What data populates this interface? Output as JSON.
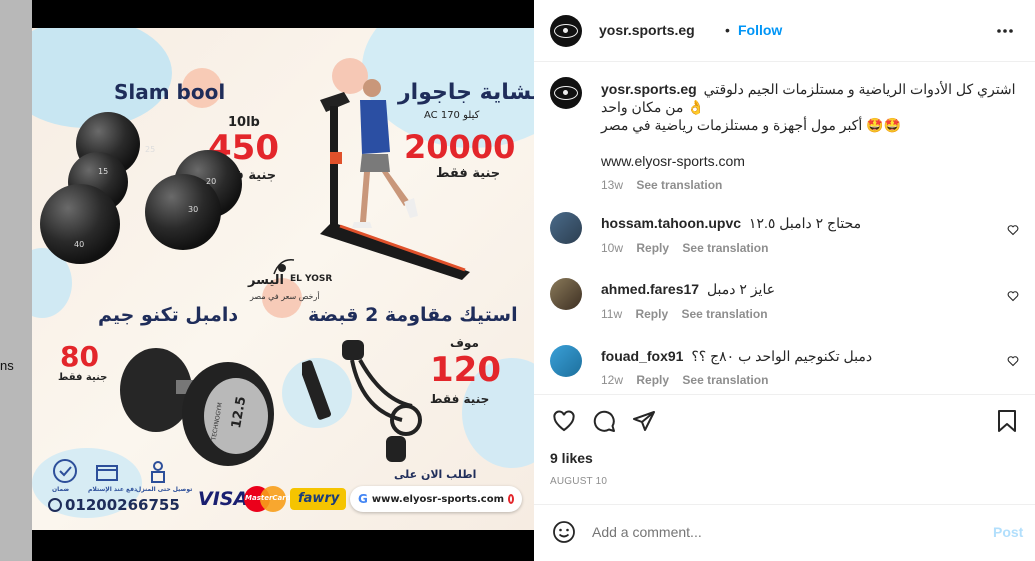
{
  "background": {
    "fragment": "ns"
  },
  "post": {
    "account": "yosr.sports.eg",
    "follow": "Follow",
    "separator": "•",
    "caption": {
      "username": "yosr.sports.eg",
      "line1": "اشتري كل الأدوات الرياضية و مستلزمات الجيم دلوقتي",
      "line2": "من مكان واحد 👌",
      "line3": "أكبر مول أجهزة و مستلزمات رياضية في مصر 🤩🤩",
      "link": "www.elyosr-sports.com",
      "time": "13w",
      "translate": "See translation"
    },
    "comments": [
      {
        "username": "hossam.tahoon.upvc",
        "text": "محتاج ٢ دامبل ١٢.٥",
        "time": "10w",
        "reply": "Reply",
        "translate": "See translation"
      },
      {
        "username": "ahmed.fares17",
        "text": "عايز ٢ دمبل",
        "time": "11w",
        "reply": "Reply",
        "translate": "See translation"
      },
      {
        "username": "fouad_fox91",
        "text": "دمبل تكنوجيم الواحد ب ٨٠ج ؟؟",
        "time": "12w",
        "reply": "Reply",
        "translate": "See translation"
      }
    ],
    "likes": "9 likes",
    "date": "AUGUST 10",
    "comment_placeholder": "Add a comment...",
    "post_button": "Post",
    "colors": {
      "accent": "#0095f6",
      "post_disabled": "#b2dffc",
      "secondary": "#8e8e8e"
    }
  },
  "ad": {
    "slam_title": "Slam bool",
    "slam_weight": "10lb",
    "slam_price": "450",
    "slam_currency": "جنية فقط",
    "treadmill_title": "مشاية جاجوار",
    "treadmill_spec": "AC 170 كيلو",
    "treadmill_price": "20000",
    "treadmill_currency": "جنية فقط",
    "brand_en": "EL YOSR",
    "brand_ar": "اليسر",
    "brand_tagline": "أرخص سعر في مصر",
    "dumbbell_title": "دامبل تكنو جيم",
    "dumbbell_price": "80",
    "dumbbell_currency": "جنية فقط",
    "dumbbell_label": "12.5",
    "dumbbell_brand": "TECHNOGYM",
    "band_title": "استيك مقاومة 2 قبضة",
    "band_prefix": "موف",
    "band_price": "120",
    "band_currency": "جنية فقط",
    "ball_labels": [
      "25",
      "15",
      "20",
      "30",
      "40"
    ],
    "badge_labels": [
      "ضمان",
      "دفع عند الإستلام",
      "توصيل حتى المنزل"
    ],
    "phone": "01200266755",
    "order_now": "اطلب الان على",
    "website": "www.elyosr-sports.com",
    "visa": "VISA",
    "mastercard": "MasterCard",
    "fawry": "fawry",
    "google_letter": "G",
    "colors": {
      "price_red": "#e3262b",
      "title_navy": "#1f2d5a",
      "visa_blue": "#1a1f71"
    }
  }
}
